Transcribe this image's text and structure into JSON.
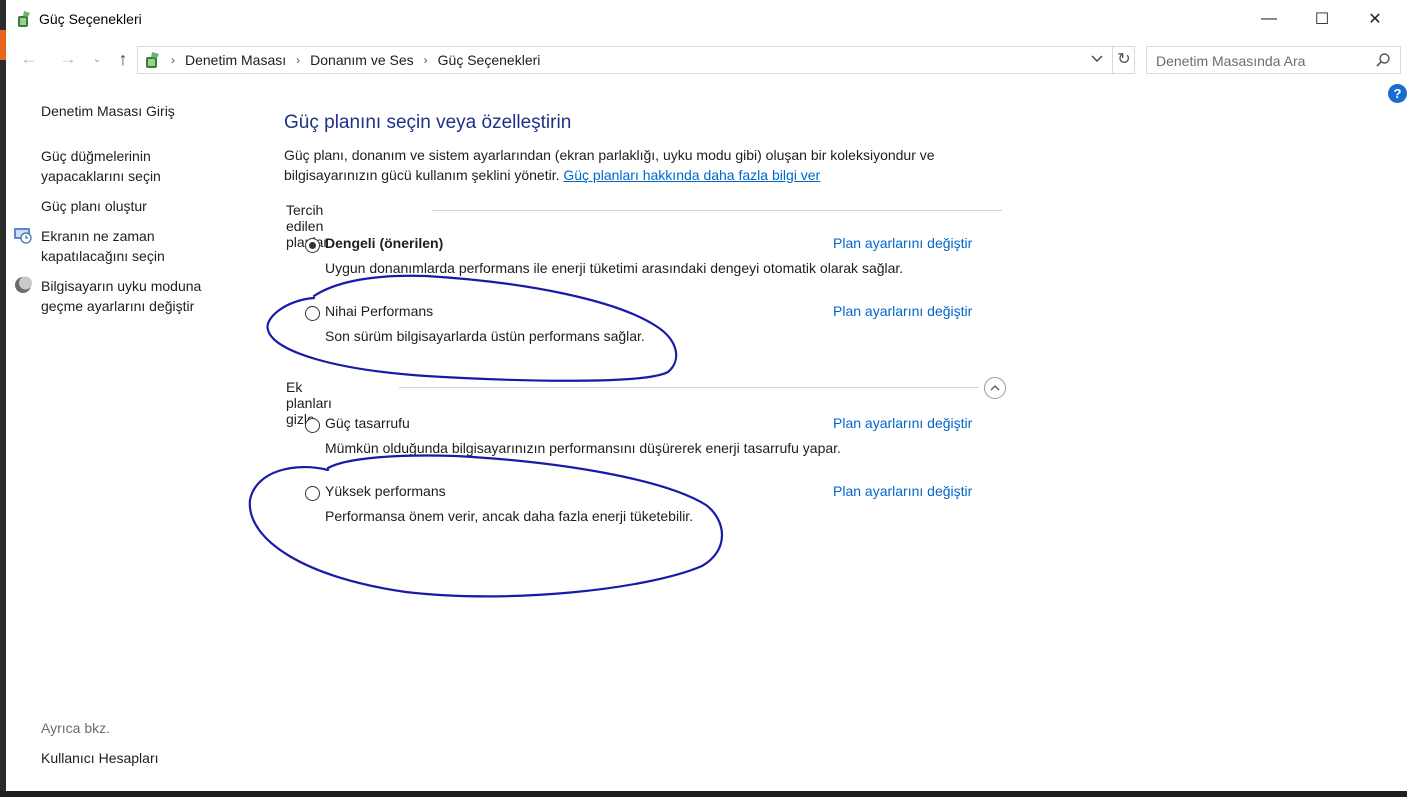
{
  "window": {
    "title": "Güç Seçenekleri",
    "controls": {
      "minimize": "—",
      "maximize": "☐",
      "close": "✕"
    }
  },
  "address": {
    "breadcrumbs": [
      "Denetim Masası",
      "Donanım ve Ses",
      "Güç Seçenekleri"
    ],
    "separator": "›"
  },
  "search": {
    "placeholder": "Denetim Masasında Ara"
  },
  "help": {
    "label": "?"
  },
  "sidebar": {
    "home": "Denetim Masası Giriş",
    "links": [
      {
        "label_line1": "Güç düğmelerinin",
        "label_line2": "yapacaklarını seçin"
      },
      {
        "label_line1": "Güç planı oluştur"
      },
      {
        "label_line1": "Ekranın ne zaman",
        "label_line2": "kapatılacağını seçin",
        "icon": "monitor-clock-icon"
      },
      {
        "label_line1": "Bilgisayarın uyku moduna",
        "label_line2": "geçme ayarlarını değiştir",
        "icon": "moon-icon"
      }
    ],
    "see_also_label": "Ayrıca bkz.",
    "see_also_link": "Kullanıcı Hesapları"
  },
  "main": {
    "title": "Güç planını seçin veya özelleştirin",
    "intro_line1": "Güç planı, donanım ve sistem ayarlarından (ekran parlaklığı, uyku modu gibi) oluşan bir koleksiyondur ve",
    "intro_line2": "bilgisayarınızın gücü kullanım şeklini yönetir.",
    "intro_link": "Güç planları hakkında daha fazla bilgi ver",
    "preferred_section": "Tercih edilen planlar",
    "extra_section": "Ek planları gizle",
    "change_link": "Plan ayarlarını değiştir",
    "plans": [
      {
        "name": "Dengeli (önerilen)",
        "desc": "Uygun donanımlarda performans ile enerji tüketimi arasındaki dengeyi otomatik olarak sağlar.",
        "selected": true
      },
      {
        "name": "Nihai Performans",
        "desc": "Son sürüm bilgisayarlarda üstün performans sağlar.",
        "selected": false
      },
      {
        "name": "Güç tasarrufu",
        "desc": "Mümkün olduğunda bilgisayarınızın performansını düşürerek enerji tasarrufu yapar.",
        "selected": false
      },
      {
        "name": "Yüksek performans",
        "desc": "Performansa önem verir, ancak daha fazla enerji tüketebilir.",
        "selected": false
      }
    ]
  },
  "colors": {
    "link": "#0066cc",
    "title": "#1e3287",
    "annotation": "#1a1aa8"
  }
}
